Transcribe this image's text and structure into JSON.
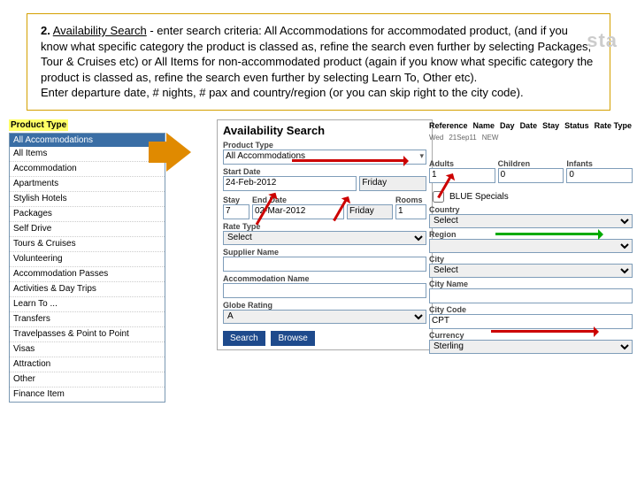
{
  "instruction": {
    "num": "2.",
    "link": "Availability Search",
    "text": " - enter search criteria: All Accommodations for accommodated product, (and if you know what specific category the product is classed as, refine the search even further by selecting Packages, Tour & Cruises etc) or All Items for non-accommodated product (again if you know what specific category the product is classed as, refine the search even further by selecting Learn To, Other etc).",
    "text2": "Enter departure date, # nights, # pax and country/region (or you can skip right to the city code)."
  },
  "productType": {
    "label": "Product Type",
    "selected": "All Accommodations",
    "items": [
      "All Items",
      "Accommodation",
      "Apartments",
      "Stylish Hotels",
      "Packages",
      "Self Drive",
      "Tours & Cruises",
      "Volunteering",
      "Accommodation Passes",
      "Activities & Day Trips",
      "Learn To ...",
      "Transfers",
      "Travelpasses & Point to Point",
      "Visas",
      "Attraction",
      "Other",
      "Finance Item"
    ]
  },
  "avail": {
    "title": "Availability Search",
    "pt_label": "Product Type",
    "pt_value": "All Accommodations",
    "sd_label": "Start Date",
    "sd_value": "24-Feb-2012",
    "sd_day": "Friday",
    "stay_label": "Stay",
    "stay_value": "7",
    "ed_label": "End Date",
    "ed_value": "02-Mar-2012",
    "ed_day": "Friday",
    "rooms_label": "Rooms",
    "rooms_value": "1",
    "rt_label": "Rate Type",
    "rt_value": "Select",
    "sn_label": "Supplier Name",
    "an_label": "Accommodation Name",
    "gr_label": "Globe Rating",
    "gr_value": "A",
    "btn1": "Search",
    "btn2": "Browse"
  },
  "right": {
    "hdr": [
      "Reference",
      "Name",
      "Day",
      "Date",
      "Stay",
      "Status",
      "Rate Type"
    ],
    "row": [
      "",
      "",
      "Wed",
      "21Sep11",
      "",
      "NEW",
      ""
    ],
    "adults_l": "Adults",
    "adults_v": "1",
    "children_l": "Children",
    "children_v": "0",
    "infants_l": "Infants",
    "infants_v": "0",
    "chk_label": "BLUE Specials",
    "country_l": "Country",
    "country_v": "Select",
    "region_l": "Region",
    "region_v": "",
    "city_l": "City",
    "city_v": "Select",
    "cityname_l": "City Name",
    "citycode_l": "City Code",
    "citycode_v": "CPT",
    "currency_l": "Currency",
    "currency_v": "Sterling"
  },
  "logo": "sta"
}
